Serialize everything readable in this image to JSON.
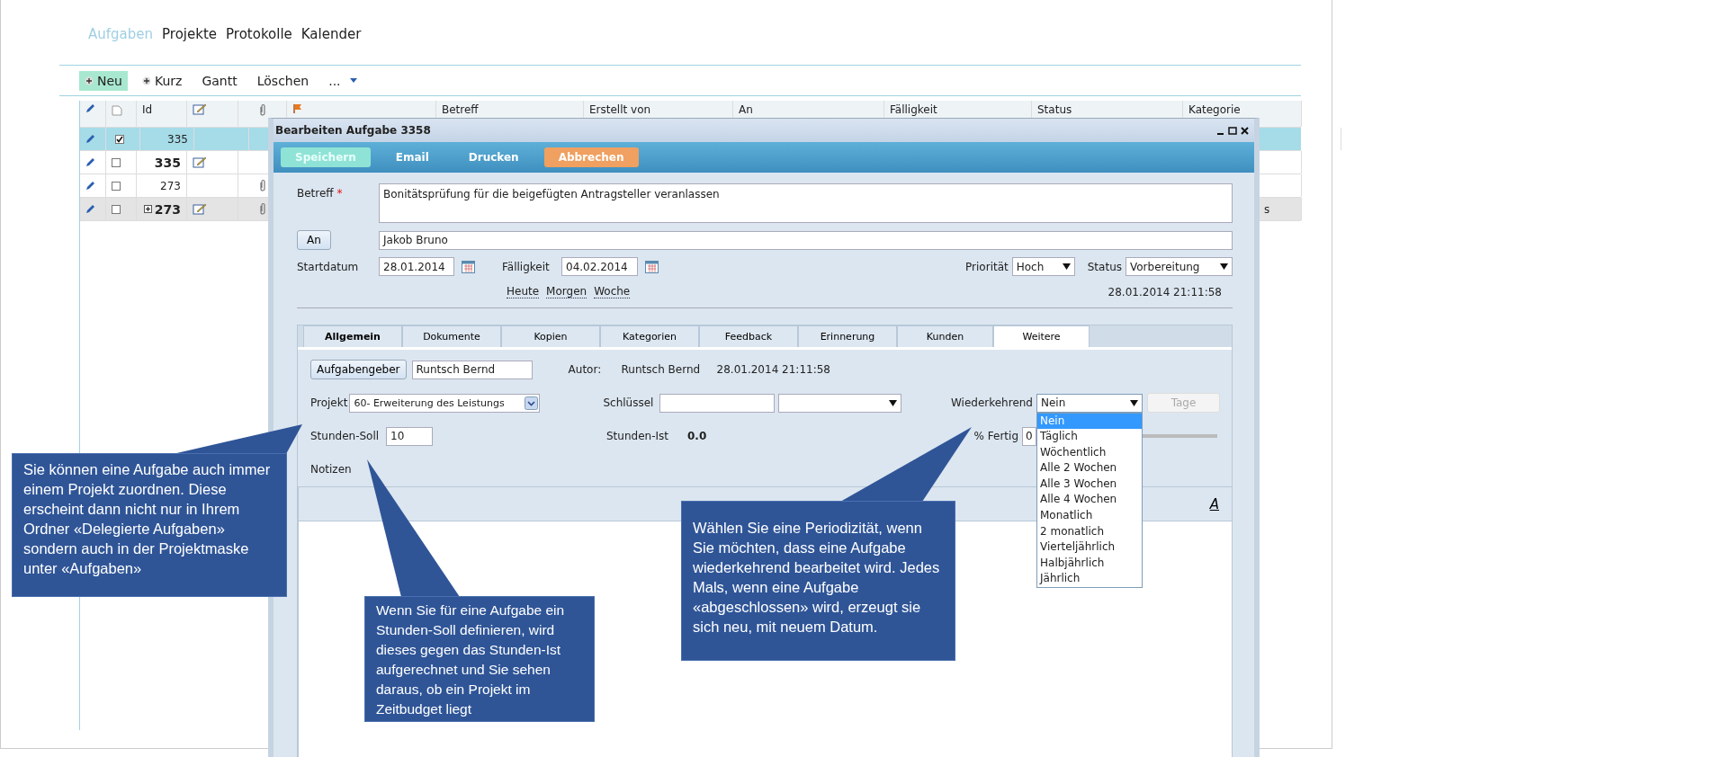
{
  "nav": [
    {
      "label": "Aufgaben",
      "selected": true
    },
    {
      "label": "Projekte",
      "selected": false
    },
    {
      "label": "Protokolle",
      "selected": false
    },
    {
      "label": "Kalender",
      "selected": false
    }
  ],
  "toolbar": [
    {
      "label": "Neu",
      "kind": "add",
      "highlighted": true
    },
    {
      "label": "Kurz",
      "kind": "add",
      "highlighted": false
    },
    {
      "label": "Gantt",
      "kind": "plain",
      "highlighted": false
    },
    {
      "label": "Löschen",
      "kind": "plain",
      "highlighted": false
    },
    {
      "label": "...",
      "kind": "menu",
      "highlighted": false
    }
  ],
  "table": {
    "columns": [
      {
        "kind": "pencil"
      },
      {
        "kind": "document"
      },
      {
        "kind": "text",
        "label": "Id"
      },
      {
        "kind": "note"
      },
      {
        "kind": "clip"
      },
      {
        "kind": "flag"
      },
      {
        "kind": "text",
        "label": "Betreff"
      },
      {
        "kind": "text",
        "label": "Erstellt von"
      },
      {
        "kind": "text",
        "label": "An"
      },
      {
        "kind": "text",
        "label": "Fälligkeit"
      },
      {
        "kind": "text",
        "label": "Status"
      },
      {
        "kind": "text",
        "label": "Kategorie"
      }
    ],
    "rows": [
      {
        "id": "335",
        "selected": true,
        "checked": true,
        "bold": false,
        "expandable": false,
        "note": false,
        "attachment": false,
        "shaded": false
      },
      {
        "id": "335",
        "selected": false,
        "checked": false,
        "bold": true,
        "expandable": false,
        "note": true,
        "attachment": false,
        "shaded": false
      },
      {
        "id": "273",
        "selected": false,
        "checked": false,
        "bold": false,
        "expandable": false,
        "note": false,
        "attachment": true,
        "shaded": false
      },
      {
        "id": "273",
        "selected": false,
        "checked": false,
        "bold": true,
        "expandable": true,
        "note": true,
        "attachment": true,
        "shaded": true,
        "category": "s"
      }
    ]
  },
  "dialog": {
    "title": "Bearbeiten Aufgabe 3358",
    "buttons": [
      {
        "label": "Speichern",
        "kind": "save"
      },
      {
        "label": "Email",
        "kind": "plain"
      },
      {
        "label": "Drucken",
        "kind": "plain"
      },
      {
        "label": "Abbrechen",
        "kind": "cancel"
      }
    ],
    "betreff": {
      "label": "Betreff",
      "required_mark": "*",
      "value": "Bonitätsprüfung für die beigefügten Antragsteller veranlassen"
    },
    "an": {
      "button": "An",
      "value": "Jakob Bruno"
    },
    "startdatum": {
      "label": "Startdatum",
      "value": "28.01.2014"
    },
    "faelligkeit": {
      "label": "Fälligkeit",
      "value": "04.02.2014"
    },
    "quick_links": [
      "Heute",
      "Morgen",
      "Woche"
    ],
    "prioritaet": {
      "label": "Priorität",
      "value": "Hoch"
    },
    "status": {
      "label": "Status",
      "value": "Vorbereitung"
    },
    "timestamp": "28.01.2014 21:11:58",
    "tabs": [
      {
        "label": "Allgemein",
        "selected": false,
        "bold": true
      },
      {
        "label": "Dokumente",
        "selected": false,
        "bold": false
      },
      {
        "label": "Kopien",
        "selected": false,
        "bold": false
      },
      {
        "label": "Kategorien",
        "selected": false,
        "bold": false
      },
      {
        "label": "Feedback",
        "selected": false,
        "bold": false
      },
      {
        "label": "Erinnerung",
        "selected": false,
        "bold": false
      },
      {
        "label": "Kunden",
        "selected": false,
        "bold": false
      },
      {
        "label": "Weitere",
        "selected": true,
        "bold": false
      }
    ],
    "panel": {
      "aufgabengeber": {
        "button": "Aufgabengeber",
        "value": "Runtsch Bernd"
      },
      "autor": {
        "label": "Autor:",
        "name": "Runtsch Bernd",
        "date": "28.01.2014 21:11:58"
      },
      "projekt": {
        "label": "Projekt",
        "value": "60- Erweiterung des Leistungs"
      },
      "schluessel": {
        "label": "Schlüssel"
      },
      "wiederkehrend": {
        "label": "Wiederkehrend",
        "value": "Nein",
        "expanded": true,
        "options": [
          {
            "label": "Nein",
            "selected": true
          },
          {
            "label": "Täglich",
            "selected": false
          },
          {
            "label": "Wöchentlich",
            "selected": false
          },
          {
            "label": "Alle 2 Wochen",
            "selected": false
          },
          {
            "label": "Alle 3 Wochen",
            "selected": false
          },
          {
            "label": "Alle 4 Wochen",
            "selected": false
          },
          {
            "label": "Monatlich",
            "selected": false
          },
          {
            "label": "2 monatlich",
            "selected": false
          },
          {
            "label": "Vierteljährlich",
            "selected": false
          },
          {
            "label": "Halbjährlich",
            "selected": false
          },
          {
            "label": "Jährlich",
            "selected": false
          }
        ]
      },
      "tage": {
        "label": "Tage",
        "disabled": true
      },
      "stunden_soll": {
        "label": "Stunden-Soll",
        "value": "10"
      },
      "stunden_ist": {
        "label": "Stunden-Ist",
        "value": "0.0"
      },
      "fertig": {
        "label": "% Fertig",
        "value": "0",
        "level": 0
      },
      "notizen": {
        "label": "Notizen",
        "format_button": "A"
      }
    }
  },
  "callouts": [
    {
      "text": "Sie können eine Aufgabe auch immer einem Projekt zuordnen. Diese erscheint dann nicht nur in Ihrem Ordner «Delegierte Aufgaben» sondern auch in der Projektmaske unter «Aufgaben»"
    },
    {
      "text": "Wenn Sie für eine Aufgabe ein Stunden-Soll definieren, wird dieses gegen das Stunden-Ist aufgerechnet und Sie sehen daraus, ob ein Projekt im Zeitbudget liegt"
    },
    {
      "text": "Wählen Sie eine Periodizität, wenn Sie möchten, dass eine Aufgabe wiederkehrend bearbeitet wird. Jedes Mals, wenn eine Aufgabe «abgeschlossen» wird, erzeugt sie sich neu, mit neuem Datum."
    }
  ]
}
